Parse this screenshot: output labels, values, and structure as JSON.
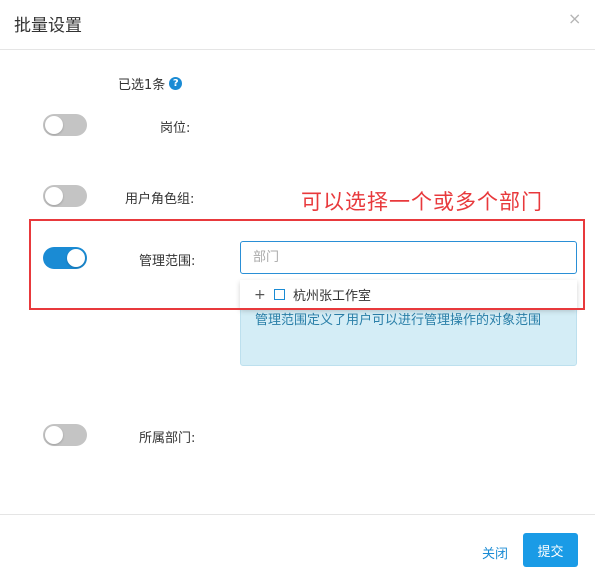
{
  "dialog": {
    "title": "批量设置",
    "close_glyph": "×"
  },
  "selection": {
    "text": "已选1条",
    "help_glyph": "?"
  },
  "fields": [
    {
      "label": "岗位:",
      "enabled": false
    },
    {
      "label": "用户角色组:",
      "enabled": false
    },
    {
      "label": "管理范围:",
      "enabled": true
    },
    {
      "label": "所属部门:",
      "enabled": false
    }
  ],
  "annotation": {
    "text": "可以选择一个或多个部门",
    "color": "#e8393c"
  },
  "scope": {
    "placeholder": "部门",
    "value": "",
    "dropdown_items": [
      {
        "label": "杭州张工作室",
        "expand_glyph": "+",
        "checked": false
      }
    ],
    "info_text": "管理范围定义了用户可以进行管理操作的对象范围"
  },
  "footer": {
    "close_label": "关闭",
    "submit_label": "提交"
  },
  "colors": {
    "accent": "#1a8bd4",
    "toggle_off": "#c4c4c4",
    "info_bg": "#d4edf6"
  },
  "icons": {
    "close": "close-icon",
    "help": "help-icon",
    "expand": "plus-icon",
    "checkbox": "checkbox-icon"
  }
}
